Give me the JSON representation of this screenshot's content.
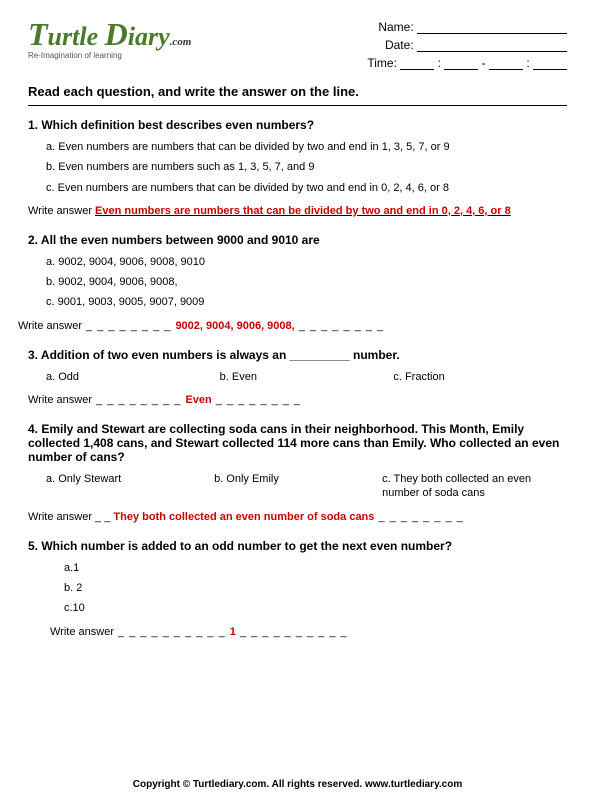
{
  "logo": {
    "brand": "Turtle Diary",
    "t1": "T",
    "rest1": "urtle",
    "t2": "D",
    "rest2": "iary",
    "dotcom": ".com",
    "tagline": "Re-Imagination of learning"
  },
  "meta": {
    "name_label": "Name:",
    "date_label": "Date:",
    "time_label": "Time:",
    "colon": ":",
    "dash": "-"
  },
  "instructions": "Read each question, and write the answer on the line.",
  "write_answer": "Write answer",
  "dashes_short": " _ _ _ _ _ _ _ _ ",
  "dashes_med": " _ _ _ _ _ _ _ _ _ _ ",
  "dashes_long": " _ _ _ _ _ _ _ _ _ _ _ _ _ _ _ _ _ _ _ _ _ _ _ _ _ _ _ _",
  "q1": {
    "text": "1. Which definition best describes  even numbers?",
    "a": "a. Even numbers are numbers that can be divided by two and end in 1, 3, 5, 7, or 9",
    "b": "b. Even numbers are numbers such as 1, 3, 5, 7, and 9",
    "c": "c. Even numbers are numbers that can be divided by two and end in 0, 2, 4, 6, or 8",
    "answer": "Even numbers are numbers that can be divided by two and end in 0, 2, 4, 6, or 8"
  },
  "q2": {
    "text": "2. All the even numbers between 9000 and 9010 are",
    "a": "a. 9002, 9004, 9006, 9008, 9010",
    "b": "b. 9002, 9004, 9006, 9008,",
    "c": "c. 9001, 9003, 9005, 9007, 9009",
    "answer": "9002, 9004, 9006, 9008,"
  },
  "q3": {
    "text": "3. Addition of two even numbers is always an _________ number.",
    "a": "a. Odd",
    "b": "b. Even",
    "c": "c. Fraction",
    "answer": "Even"
  },
  "q4": {
    "text": "4. Emily and Stewart are collecting soda cans in their neighborhood.  This Month, Emily collected 1,408 cans, and Stewart collected 114 more cans than Emily.  Who collected an even number of cans?",
    "a": "a. Only Stewart",
    "b": "b. Only Emily",
    "c": "c. They both collected an even number of soda cans",
    "answer": "They both collected an even number of soda cans"
  },
  "q5": {
    "text": "5. Which number is added to an odd number to get the next even number?",
    "a": "a.1",
    "b": "b. 2",
    "c": "c.10",
    "answer": "1"
  },
  "footer": "Copyright © Turtlediary.com. All rights reserved.  www.turtlediary.com"
}
